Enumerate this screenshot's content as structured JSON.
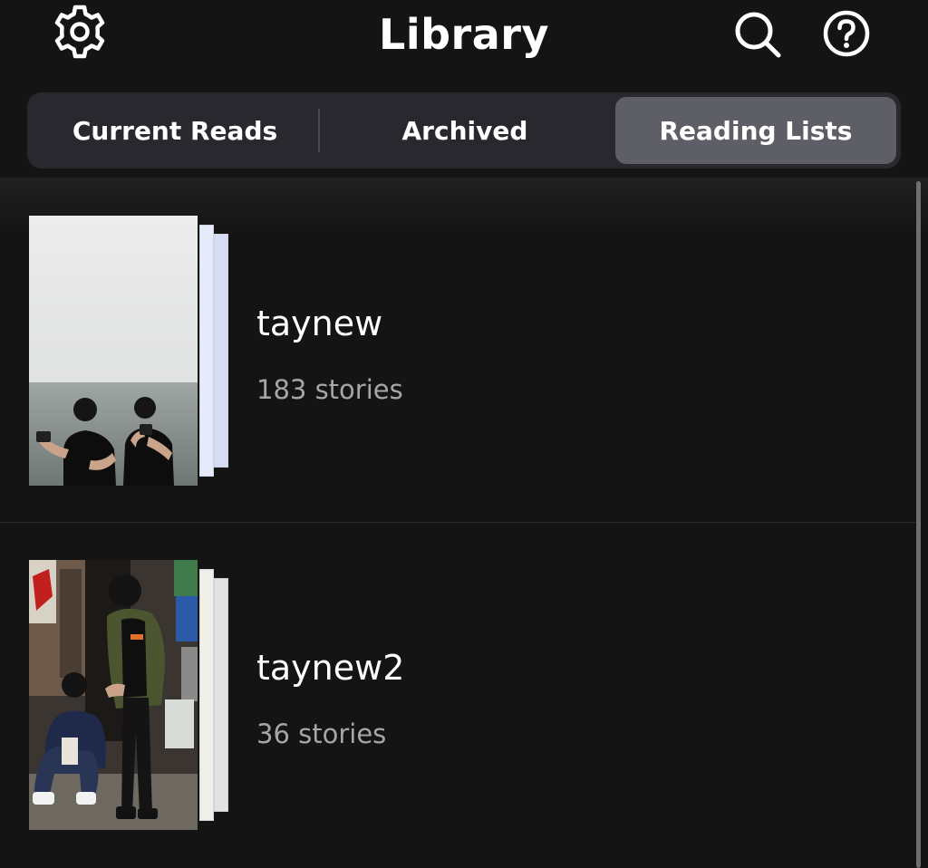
{
  "header": {
    "title": "Library",
    "left_icon": "gear-icon",
    "right_icons": [
      "search-icon",
      "help-icon"
    ]
  },
  "tabs": [
    {
      "label": "Current Reads",
      "selected": false
    },
    {
      "label": "Archived",
      "selected": false
    },
    {
      "label": "Reading Lists",
      "selected": true
    }
  ],
  "reading_lists": [
    {
      "title": "taynew",
      "count": "183 stories"
    },
    {
      "title": "taynew2",
      "count": "36 stories"
    }
  ],
  "colors": {
    "background": "#141414",
    "tab_bar": "#28282e",
    "tab_selected": "#5e5e66",
    "secondary_text": "#a6a6a6"
  }
}
